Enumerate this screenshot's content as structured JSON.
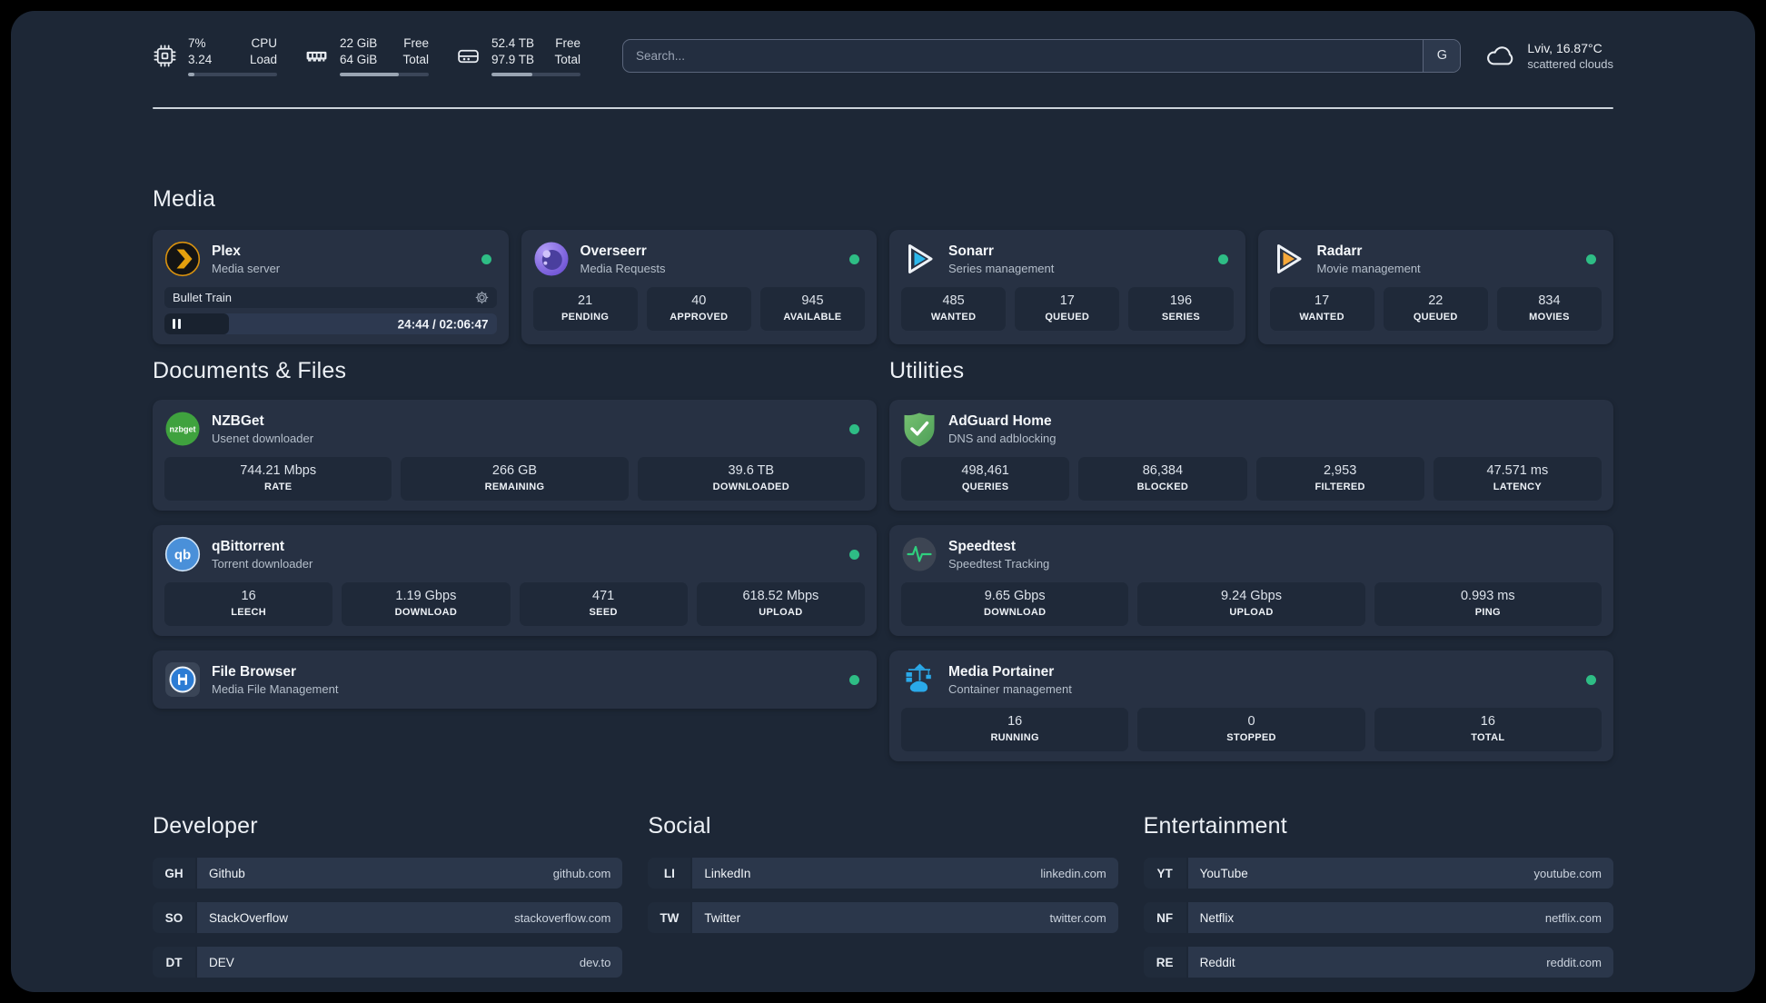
{
  "topbar": {
    "cpu": {
      "icon": "cpu-icon",
      "values": [
        "7%",
        "3.24"
      ],
      "labels": [
        "CPU",
        "Load"
      ],
      "progress_pct": 7
    },
    "memory": {
      "icon": "memory-icon",
      "values": [
        "22 GiB",
        "64 GiB"
      ],
      "labels": [
        "Free",
        "Total"
      ],
      "progress_pct": 66
    },
    "disk": {
      "icon": "disk-icon",
      "values": [
        "52.4 TB",
        "97.9 TB"
      ],
      "labels": [
        "Free",
        "Total"
      ],
      "progress_pct": 46
    },
    "search": {
      "placeholder": "Search...",
      "button": "G"
    },
    "weather": {
      "icon": "cloud-icon",
      "line1": "Lviv, 16.87°C",
      "line2": "scattered clouds"
    }
  },
  "sections": {
    "media": {
      "title": "Media",
      "apps": [
        {
          "name": "Plex",
          "description": "Media server",
          "icon": "plex-icon",
          "online": true,
          "player": {
            "title": "Bullet Train",
            "time": "24:44 / 02:06:47",
            "progress_pct": 19.5
          }
        },
        {
          "name": "Overseerr",
          "description": "Media Requests",
          "icon": "overseerr-icon",
          "online": true,
          "stats": [
            {
              "value": "21",
              "label": "PENDING"
            },
            {
              "value": "40",
              "label": "APPROVED"
            },
            {
              "value": "945",
              "label": "AVAILABLE"
            }
          ]
        },
        {
          "name": "Sonarr",
          "description": "Series management",
          "icon": "sonarr-icon",
          "online": true,
          "stats": [
            {
              "value": "485",
              "label": "WANTED"
            },
            {
              "value": "17",
              "label": "QUEUED"
            },
            {
              "value": "196",
              "label": "SERIES"
            }
          ]
        },
        {
          "name": "Radarr",
          "description": "Movie management",
          "icon": "radarr-icon",
          "online": true,
          "stats": [
            {
              "value": "17",
              "label": "WANTED"
            },
            {
              "value": "22",
              "label": "QUEUED"
            },
            {
              "value": "834",
              "label": "MOVIES"
            }
          ]
        }
      ]
    },
    "documents": {
      "title": "Documents & Files",
      "apps": [
        {
          "name": "NZBGet",
          "description": "Usenet downloader",
          "icon": "nzbget-icon",
          "online": true,
          "stats": [
            {
              "value": "744.21 Mbps",
              "label": "RATE"
            },
            {
              "value": "266 GB",
              "label": "REMAINING"
            },
            {
              "value": "39.6 TB",
              "label": "DOWNLOADED"
            }
          ]
        },
        {
          "name": "qBittorrent",
          "description": "Torrent downloader",
          "icon": "qbittorrent-icon",
          "online": true,
          "stats": [
            {
              "value": "16",
              "label": "LEECH"
            },
            {
              "value": "1.19 Gbps",
              "label": "DOWNLOAD"
            },
            {
              "value": "471",
              "label": "SEED"
            },
            {
              "value": "618.52 Mbps",
              "label": "UPLOAD"
            }
          ]
        },
        {
          "name": "File Browser",
          "description": "Media File Management",
          "icon": "filebrowser-icon",
          "online": true
        }
      ]
    },
    "utilities": {
      "title": "Utilities",
      "apps": [
        {
          "name": "AdGuard Home",
          "description": "DNS and adblocking",
          "icon": "adguard-icon",
          "online": false,
          "stats": [
            {
              "value": "498,461",
              "label": "QUERIES"
            },
            {
              "value": "86,384",
              "label": "BLOCKED"
            },
            {
              "value": "2,953",
              "label": "FILTERED"
            },
            {
              "value": "47.571 ms",
              "label": "LATENCY"
            }
          ]
        },
        {
          "name": "Speedtest",
          "description": "Speedtest Tracking",
          "icon": "speedtest-icon",
          "online": false,
          "stats": [
            {
              "value": "9.65 Gbps",
              "label": "DOWNLOAD"
            },
            {
              "value": "9.24 Gbps",
              "label": "UPLOAD"
            },
            {
              "value": "0.993 ms",
              "label": "PING"
            }
          ]
        },
        {
          "name": "Media Portainer",
          "description": "Container management",
          "icon": "portainer-icon",
          "online": true,
          "stats": [
            {
              "value": "16",
              "label": "RUNNING"
            },
            {
              "value": "0",
              "label": "STOPPED"
            },
            {
              "value": "16",
              "label": "TOTAL"
            }
          ]
        }
      ]
    }
  },
  "bookmarks": [
    {
      "title": "Developer",
      "links": [
        {
          "abbr": "GH",
          "name": "Github",
          "url": "github.com"
        },
        {
          "abbr": "SO",
          "name": "StackOverflow",
          "url": "stackoverflow.com"
        },
        {
          "abbr": "DT",
          "name": "DEV",
          "url": "dev.to"
        }
      ]
    },
    {
      "title": "Social",
      "links": [
        {
          "abbr": "LI",
          "name": "LinkedIn",
          "url": "linkedin.com"
        },
        {
          "abbr": "TW",
          "name": "Twitter",
          "url": "twitter.com"
        }
      ]
    },
    {
      "title": "Entertainment",
      "links": [
        {
          "abbr": "YT",
          "name": "YouTube",
          "url": "youtube.com"
        },
        {
          "abbr": "NF",
          "name": "Netflix",
          "url": "netflix.com"
        },
        {
          "abbr": "RE",
          "name": "Reddit",
          "url": "reddit.com"
        }
      ]
    }
  ],
  "colors": {
    "page_bg": "#1d2736",
    "card_bg": "#273143",
    "stat_bg": "#1f2939",
    "status_online": "#2ebd85",
    "plex_amber": "#e5a00d",
    "sonarr_blue": "#2cb8ec",
    "radarr_orange": "#f6a83a",
    "adguard_green": "#5fb45f",
    "portainer_blue": "#2aa9e9",
    "nzbget_green": "#3fa23e",
    "qbittorrent_blue": "#4a90d9",
    "speedtest_pulse": "#2fd07e"
  }
}
